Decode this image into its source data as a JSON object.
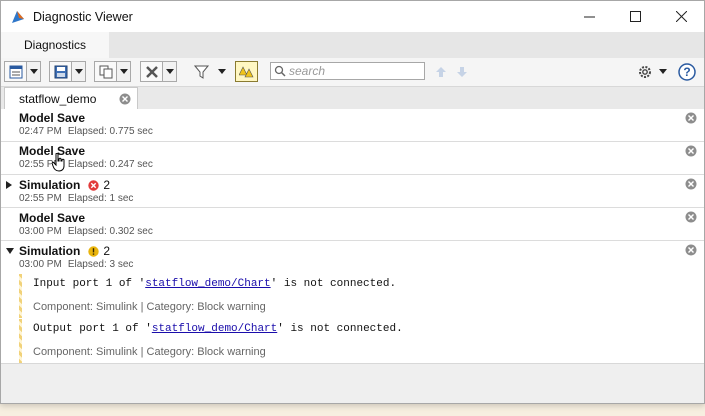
{
  "window": {
    "title": "Diagnostic Viewer"
  },
  "toolstrip": {
    "tab": "Diagnostics"
  },
  "search": {
    "placeholder": "search"
  },
  "model_tab": {
    "label": "statflow_demo"
  },
  "entries": [
    {
      "title": "Model Save",
      "time": "02:47 PM",
      "elapsed": "Elapsed: 0.775 sec"
    },
    {
      "title": "Model Save",
      "time": "02:55 PM",
      "elapsed": "Elapsed: 0.247 sec"
    },
    {
      "title": "Simulation",
      "time": "02:55 PM",
      "elapsed": "Elapsed: 1 sec",
      "count": "2",
      "badge": "error"
    },
    {
      "title": "Model Save",
      "time": "03:00 PM",
      "elapsed": "Elapsed: 0.302 sec"
    },
    {
      "title": "Simulation",
      "time": "03:00 PM",
      "elapsed": "Elapsed: 3 sec",
      "count": "2",
      "badge": "warning",
      "messages": [
        {
          "pre": "Input port 1 of '",
          "link": "statflow_demo/Chart",
          "post": "' is not connected.",
          "meta": "Component:  Simulink | Category:  Block warning"
        },
        {
          "pre": "Output port 1 of '",
          "link": "statflow_demo/Chart",
          "post": "' is not connected.",
          "meta": "Component:  Simulink | Category:  Block warning"
        }
      ]
    }
  ],
  "colors": {
    "error": "#e23b3b",
    "warning": "#e9b40c",
    "link": "#1a0dab"
  }
}
